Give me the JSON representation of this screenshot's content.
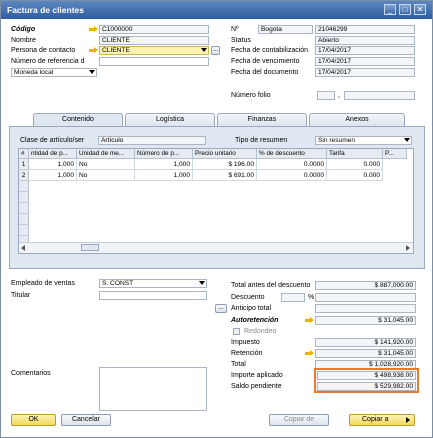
{
  "window": {
    "title": "Factura de clientes",
    "controls": [
      "_",
      "□",
      "✕"
    ]
  },
  "header": {
    "codigo_label": "Código",
    "codigo": "C1000000",
    "nombre_label": "Nombre",
    "nombre": "CLIENTE",
    "persona_label": "Persona de contacto",
    "persona": "CLIENTE",
    "ref_label": "Número de referencia d",
    "ref": "",
    "moneda": "Moneda local",
    "no_label": "Nº",
    "serie": "Bogota",
    "no": "21046299",
    "status_label": "Status",
    "status": "Abierto",
    "fecha_cont_label": "Fecha de contabilización",
    "fecha_cont": "17/04/2017",
    "fecha_venc_label": "Fecha de vencimiento",
    "fecha_venc": "17/04/2017",
    "fecha_doc_label": "Fecha del documento",
    "fecha_doc": "17/04/2017",
    "folio_label": "Número folio",
    "folio_a": "",
    "folio_sep": ",",
    "folio_b": ""
  },
  "tabs": [
    "Contenido",
    "Logística",
    "Finanzas",
    "Anexos"
  ],
  "content": {
    "clase_label": "Clase de artículo/ser",
    "clase": "Artículo",
    "resumen_label": "Tipo de resumen",
    "resumen": "Sin resumen",
    "columns": [
      "#",
      "ntidad de p...",
      "Unidad de me...",
      "Número de p...",
      "Precio unitario",
      "% de descuento",
      "Tarifa",
      "P..."
    ],
    "rows": [
      [
        "1",
        "1,000",
        "No",
        "1,000",
        "$ 196.00",
        "0.0000",
        "0.000"
      ],
      [
        "2",
        "1,000",
        "No",
        "1,000",
        "$ 691.00",
        "0.0000",
        "0.000"
      ]
    ]
  },
  "footer": {
    "empleado_label": "Empleado de ventas",
    "empleado": "S. CONST",
    "titular_label": "Titular",
    "titular": "",
    "comentarios_label": "Comentarios",
    "comentarios": ""
  },
  "totals": {
    "antes_label": "Total antes del descuento",
    "antes": "$ 887,000.00",
    "descuento_label": "Descuento",
    "descuento_pct": "",
    "pct_sign": "%",
    "descuento": "",
    "anticipo_label": "Anticipo total",
    "anticipo": "",
    "autoret_label": "Autoretención",
    "autoret": "$ 31,045.00",
    "redondeo_label": "Redondeo",
    "redondeo": "",
    "impuesto_label": "Impuesto",
    "impuesto": "$ 141,920.00",
    "retencion_label": "Retención",
    "retencion": "$ 31,045.00",
    "total_label": "Total",
    "total": "$ 1,028,920.00",
    "importe_label": "Importe aplicado",
    "importe": "$ 498,938.00",
    "saldo_label": "Saldo pendiente",
    "saldo": "$ 529,982.00"
  },
  "buttons": {
    "ok": "OK",
    "cancel": "Cancelar",
    "copy_from": "Copiar de",
    "copy_to": "Copiar a",
    "more": "..."
  },
  "colors": {
    "highlight": "#e87a2a",
    "title_bar": "#2f5d9f",
    "link_arrow": "#e8b400"
  }
}
